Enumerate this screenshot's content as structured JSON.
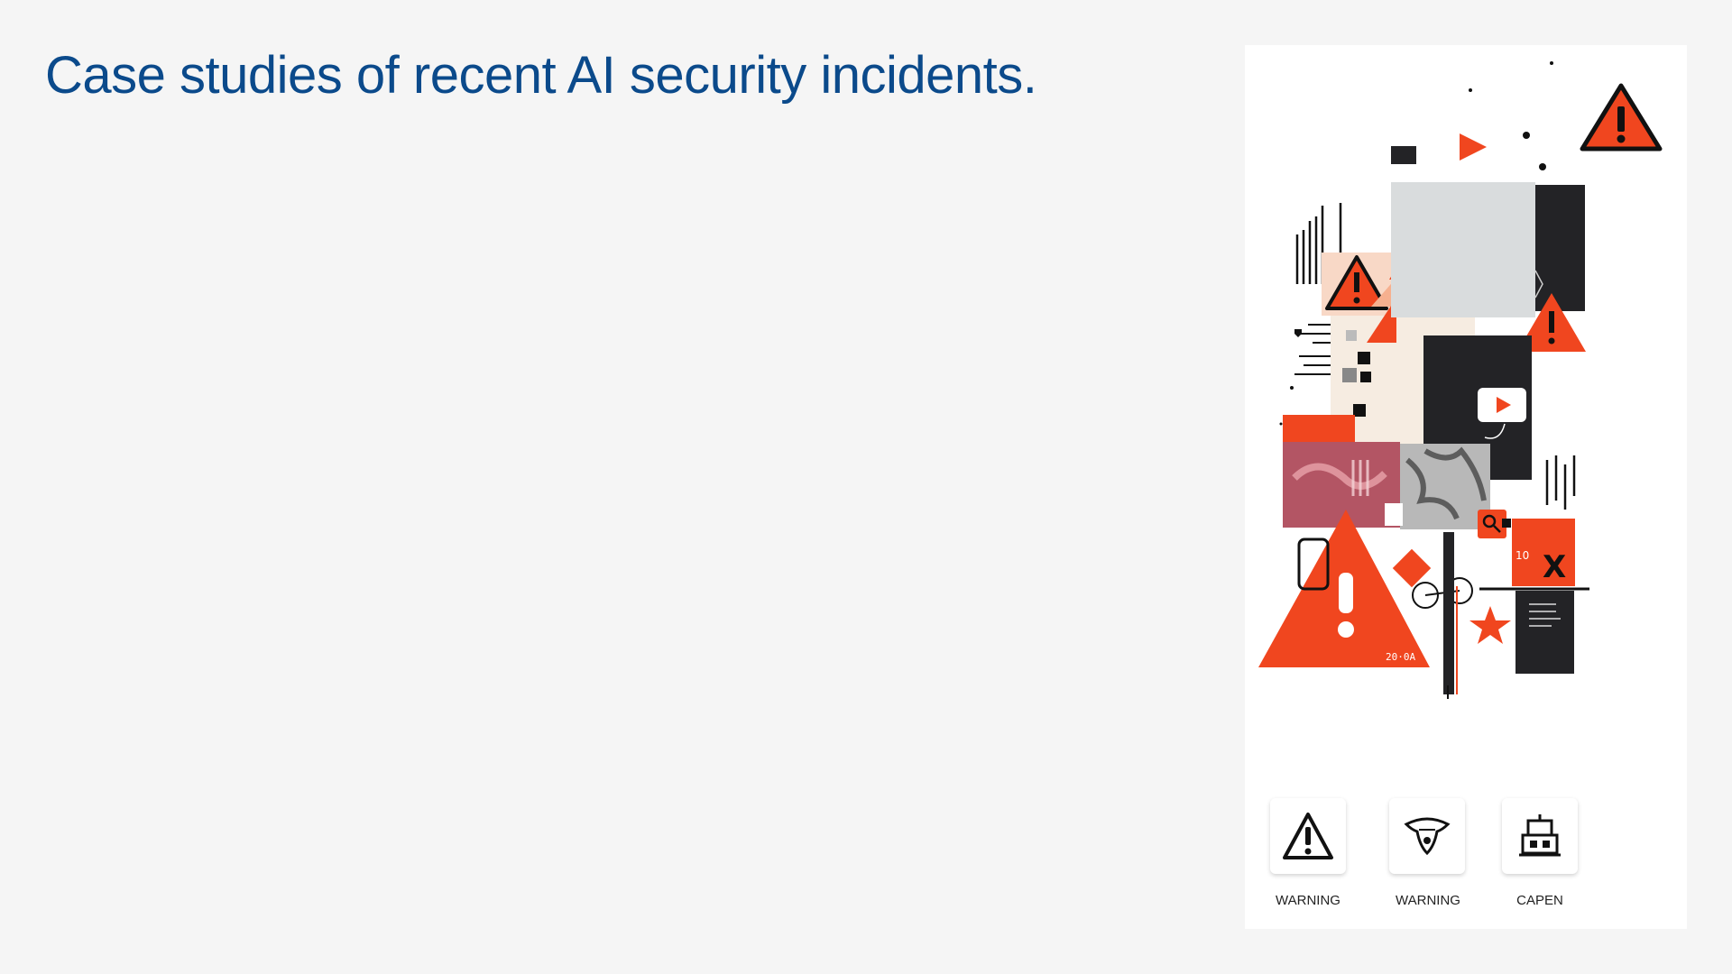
{
  "slide": {
    "title": "Case studies of recent AI security incidents."
  },
  "illustration": {
    "accent_color": "#f0461f",
    "dark_color": "#232326",
    "collage_text": {
      "counter": "10",
      "x_mark": "X",
      "year_tag": "20·0A"
    },
    "icons": [
      {
        "name": "warning-icon",
        "label": "WARNING"
      },
      {
        "name": "virus-bug-icon",
        "label": "WARNING"
      },
      {
        "name": "robot-icon",
        "label": "CAPEN"
      }
    ]
  }
}
